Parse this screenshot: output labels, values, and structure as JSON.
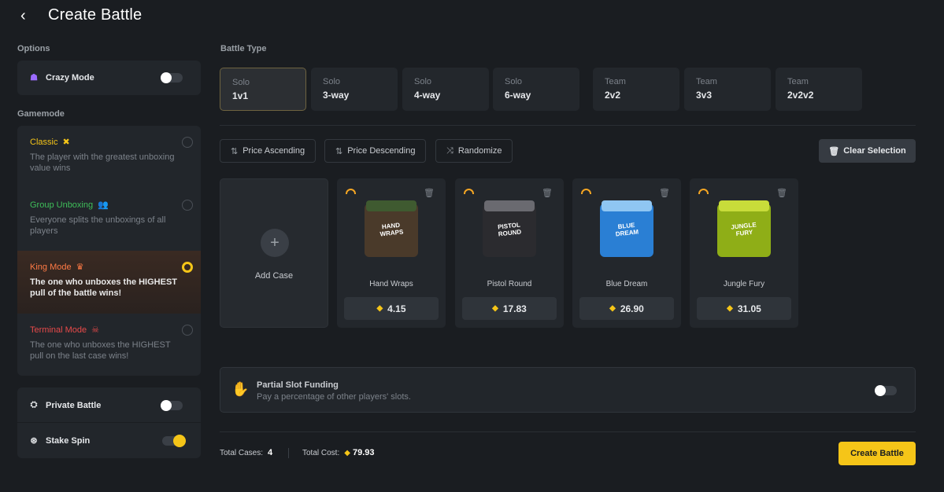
{
  "header": {
    "title": "Create Battle"
  },
  "options": {
    "label": "Options",
    "crazy_mode": {
      "label": "Crazy Mode",
      "enabled": false
    }
  },
  "gamemode": {
    "label": "Gamemode",
    "modes": [
      {
        "name": "Classic",
        "desc": "The player with the greatest unboxing value wins",
        "color": "#f5c518",
        "selected": false
      },
      {
        "name": "Group Unboxing",
        "desc": "Everyone splits the unboxings of all players",
        "color": "#3fbf5a",
        "selected": false
      },
      {
        "name": "King Mode",
        "desc": "The one who unboxes the HIGHEST pull of the battle wins!",
        "color": "#ff7a45",
        "selected": true
      },
      {
        "name": "Terminal Mode",
        "desc": "The one who unboxes the HIGHEST pull on the last case wins!",
        "color": "#e84a4a",
        "selected": false
      }
    ]
  },
  "extras": {
    "private_battle": {
      "label": "Private Battle",
      "enabled": false
    },
    "stake_spin": {
      "label": "Stake Spin",
      "enabled": true
    }
  },
  "battle_type": {
    "label": "Battle Type",
    "types": [
      {
        "sub": "Solo",
        "main": "1v1",
        "selected": true
      },
      {
        "sub": "Solo",
        "main": "3-way",
        "selected": false
      },
      {
        "sub": "Solo",
        "main": "4-way",
        "selected": false
      },
      {
        "sub": "Solo",
        "main": "6-way",
        "selected": false
      },
      {
        "sub": "Team",
        "main": "2v2",
        "selected": false
      },
      {
        "sub": "Team",
        "main": "3v3",
        "selected": false
      },
      {
        "sub": "Team",
        "main": "2v2v2",
        "selected": false
      }
    ]
  },
  "sort": {
    "asc": "Price Ascending",
    "desc": "Price Descending",
    "random": "Randomize",
    "clear": "Clear Selection"
  },
  "add_case": {
    "label": "Add Case"
  },
  "cases": [
    {
      "name": "Hand Wraps",
      "price": "4.15",
      "box_label": "HAND WRAPS",
      "color": "#4a6b3a"
    },
    {
      "name": "Pistol Round",
      "price": "17.83",
      "box_label": "PISTOL ROUND",
      "color": "#2b2b2f"
    },
    {
      "name": "Blue Dream",
      "price": "26.90",
      "box_label": "BLUE DREAM",
      "color": "#2a7fd4"
    },
    {
      "name": "Jungle Fury",
      "price": "31.05",
      "box_label": "JUNGLE FURY",
      "color": "#a8c21e"
    }
  ],
  "partial_slot": {
    "title": "Partial Slot Funding",
    "desc": "Pay a percentage of other players' slots.",
    "enabled": false
  },
  "footer": {
    "total_cases_label": "Total Cases:",
    "total_cases": "4",
    "total_cost_label": "Total Cost:",
    "total_cost": "79.93",
    "create_label": "Create Battle"
  },
  "colors": {
    "accent": "#f5c518",
    "bg": "#1a1d21",
    "panel": "#22262b"
  }
}
